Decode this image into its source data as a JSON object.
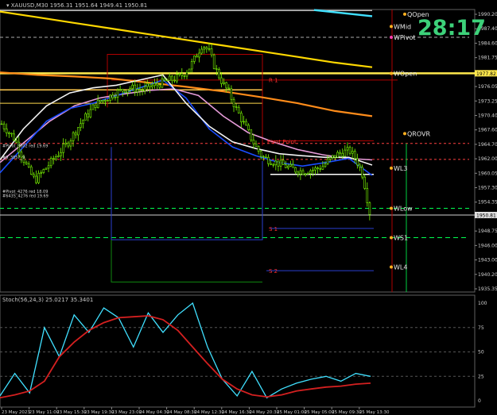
{
  "header": {
    "symbol_label": "XAUUSD,M30",
    "ohlc": "1956.31 1951.64 1949.41 1950.81"
  },
  "countdown": "28:17",
  "colors": {
    "background": "#000000",
    "candle": "#7cfc00",
    "grid": "#3a3a3a",
    "stoch_main": "#40e0ff",
    "stoch_signal": "#d42020"
  },
  "price_axis": {
    "ticks": [
      "1990.20",
      "1987.40",
      "1984.60",
      "1981.75",
      "1978.95",
      "1976.05",
      "1973.25",
      "1970.40",
      "1967.60",
      "1964.70",
      "1962.00",
      "1960.05",
      "1957.30",
      "1954.35",
      "1951.55",
      "1948.75",
      "1946.00",
      "1943.00",
      "1940.20",
      "1935.35"
    ],
    "current_price": "1950.81",
    "wopen_price": "1977.82"
  },
  "session_labels": {
    "qopen": "QOpen",
    "wmid": "WMid",
    "wpivot": "WPivot",
    "wopen": "WOpen",
    "qrovr": "QROVR",
    "wl3": "WL3",
    "wlow": "WLow",
    "ws1": "WS1",
    "wl4": "WL4"
  },
  "pivot_labels": {
    "r1": "R 1",
    "pivot": "Pivot Point",
    "s1": "S 1",
    "s2": "S 2"
  },
  "left_labels": [
    "#Pivot_3802 red 19.69",
    "#9_3857_9",
    "#Pivot_4276 red 18.09",
    "#6435_4276 red 19.69"
  ],
  "stoch": {
    "label": "Stoch(56,24,3) 25.0217 35.3401",
    "ticks": [
      "100",
      "75",
      "50",
      "25",
      "0"
    ]
  },
  "time_axis": [
    "23 May 2023",
    "23 May 11:00",
    "23 May 15:30",
    "23 May 19:30",
    "23 May 23:00",
    "24 May 04:30",
    "24 May 08:30",
    "24 May 12:30",
    "24 May 16:30",
    "24 May 20:30",
    "25 May 01:00",
    "25 May 05:00",
    "25 May 09:30",
    "25 May 13:30"
  ],
  "chart_data": [
    {
      "type": "candlestick",
      "title": "XAUUSD,M30",
      "ylim": [
        1935.35,
        1990.2
      ],
      "close_path": [
        1968,
        1966.5,
        1965,
        1962,
        1959,
        1957,
        1958.5,
        1960,
        1961.5,
        1963,
        1964.5,
        1966.5,
        1968.5,
        1970,
        1971.8,
        1972.5,
        1973.2,
        1974,
        1974.5,
        1975,
        1974.8,
        1974.5,
        1975.2,
        1975.5,
        1976,
        1976.5,
        1976.8,
        1977.5,
        1978.8,
        1981,
        1983.5,
        1982,
        1978.5,
        1976,
        1974,
        1971,
        1968.5,
        1966,
        1963.5,
        1961.5,
        1961,
        1960.5,
        1960,
        1959.5,
        1959,
        1958.8,
        1959,
        1959.2,
        1959.8,
        1961,
        1962,
        1962.5,
        1962.8,
        1961,
        1958,
        1950.8
      ],
      "moving_averages": [
        {
          "color": "#ffd800",
          "values": [
            1989.8,
            1988.7,
            1987.6,
            1986.5,
            1985.4,
            1984.3,
            1983.2,
            1982.1,
            1981.0,
            1979.9,
            1979.0
          ]
        },
        {
          "color": "#ff8c1a",
          "values": [
            1978,
            1977.5,
            1977.2,
            1976.8,
            1976,
            1975.2,
            1974.3,
            1973.2,
            1972,
            1970.5,
            1969.5
          ]
        },
        {
          "color": "#e59bd8",
          "values": [
            1960.5,
            1964.5,
            1968.5,
            1971.5,
            1973,
            1973.8,
            1974.5,
            1974.8,
            1973.5,
            1969.5,
            1966.3,
            1964.5,
            1963,
            1962,
            1961.3,
            1961
          ]
        },
        {
          "color": "#1a4dff",
          "values": [
            1958.5,
            1963.5,
            1968.5,
            1971,
            1972,
            1973.5,
            1975,
            1976.5,
            1973,
            1967,
            1963.5,
            1961.8,
            1960.5,
            1959.8,
            1960.5,
            1961.3,
            1958
          ]
        },
        {
          "color": "#f4f4f4",
          "values": [
            1961,
            1967,
            1971.5,
            1974,
            1975,
            1975.5,
            1976.5,
            1977.5,
            1972,
            1967.5,
            1964.5,
            1963.2,
            1962.2,
            1961.8,
            1961.5,
            1961.5,
            1960
          ]
        }
      ]
    },
    {
      "type": "line",
      "title": "Stoch(56,24,3) 25.0217 35.3401",
      "ylim": [
        0,
        100
      ],
      "series": [
        {
          "color": "#40e0ff",
          "values": [
            5,
            28,
            8,
            75,
            45,
            88,
            70,
            95,
            85,
            55,
            90,
            70,
            88,
            100,
            55,
            22,
            5,
            30,
            3,
            12,
            18,
            22,
            25,
            20,
            28,
            25
          ]
        },
        {
          "color": "#d42020",
          "values": [
            3,
            6,
            10,
            20,
            45,
            60,
            72,
            80,
            85,
            86,
            87,
            83,
            72,
            55,
            38,
            22,
            12,
            6,
            4,
            6,
            10,
            12,
            14,
            15,
            17,
            18
          ]
        }
      ]
    }
  ]
}
